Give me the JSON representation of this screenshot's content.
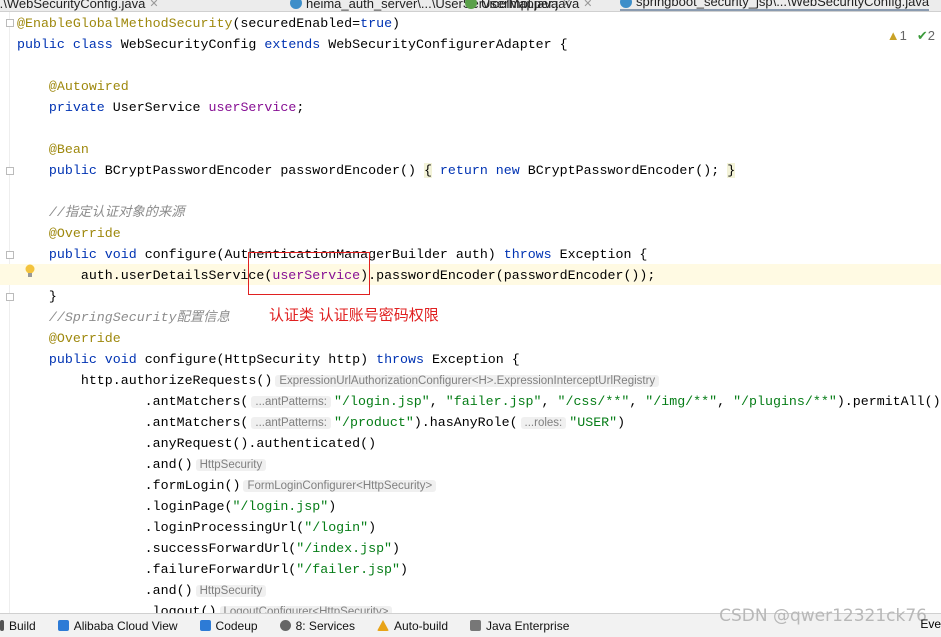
{
  "tabs": [
    {
      "label": "..\\WebSecurityConfig.java",
      "icon": "class-icon",
      "closable": true
    },
    {
      "label": "heima_auth_server\\...\\UserServiceImpl.java",
      "icon": "class-icon",
      "closable": true
    },
    {
      "label": "UserMapper.java",
      "icon": "interface-icon",
      "closable": true
    },
    {
      "label": "springboot_security_jsp\\...\\WebSecurityConfig.java",
      "icon": "class-icon",
      "active": true
    }
  ],
  "inspections": {
    "warnings": "1",
    "ok": "2"
  },
  "code": [
    [
      [
        "an",
        "@EnableGlobalMethodSecurity"
      ],
      [
        "",
        "(securedEnabled="
      ],
      [
        "kw",
        "true"
      ],
      [
        "",
        ")"
      ]
    ],
    [
      [
        "kw",
        "public class "
      ],
      [
        "",
        "WebSecurityConfig "
      ],
      [
        "kw",
        "extends "
      ],
      [
        "",
        "WebSecurityConfigurerAdapter {"
      ]
    ],
    [],
    [
      [
        "",
        "    "
      ],
      [
        "an",
        "@Autowired"
      ]
    ],
    [
      [
        "",
        "    "
      ],
      [
        "kw",
        "private "
      ],
      [
        "",
        "UserService "
      ],
      [
        "fld",
        "userService"
      ],
      [
        "",
        ";"
      ]
    ],
    [],
    [
      [
        "",
        "    "
      ],
      [
        "an",
        "@Bean"
      ]
    ],
    [
      [
        "",
        "    "
      ],
      [
        "kw",
        "public "
      ],
      [
        "",
        "BCryptPasswordEncoder passwordEncoder() "
      ],
      [
        "brace",
        "{"
      ],
      [
        "",
        ""
      ],
      [
        "kw",
        " return new "
      ],
      [
        "",
        "BCryptPasswordEncoder(); "
      ],
      [
        "brace",
        "}"
      ]
    ],
    [],
    [
      [
        "",
        "    "
      ],
      [
        "cm",
        "//指定认证对象的来源"
      ]
    ],
    [
      [
        "",
        "    "
      ],
      [
        "an",
        "@Override"
      ]
    ],
    [
      [
        "",
        "    "
      ],
      [
        "kw",
        "public void "
      ],
      [
        "",
        "configure(AuthenticationManagerBuilder auth) "
      ],
      [
        "kw",
        "throws "
      ],
      [
        "",
        "Exception {"
      ]
    ],
    [
      [
        "",
        "        auth.userDetailsService("
      ],
      [
        "fld",
        "userService"
      ],
      [
        "",
        ").passwordEncoder(passwordEncoder());"
      ]
    ],
    [
      [
        "",
        "    }"
      ]
    ],
    [
      [
        "",
        "    "
      ],
      [
        "cm",
        "//SpringSecurity配置信息"
      ]
    ],
    [
      [
        "",
        "    "
      ],
      [
        "an",
        "@Override"
      ]
    ],
    [
      [
        "",
        "    "
      ],
      [
        "kw",
        "public void "
      ],
      [
        "",
        "configure(HttpSecurity http) "
      ],
      [
        "kw",
        "throws "
      ],
      [
        "",
        "Exception {"
      ]
    ],
    [
      [
        "",
        "        http.authorizeRequests()"
      ],
      [
        "hint",
        "ExpressionUrlAuthorizationConfigurer<H>.ExpressionInterceptUrlRegistry"
      ]
    ],
    [
      [
        "",
        "                .antMatchers("
      ],
      [
        "hint",
        "...antPatterns:"
      ],
      [
        "str",
        "\"/login.jsp\""
      ],
      [
        "",
        ", "
      ],
      [
        "str",
        "\"failer.jsp\""
      ],
      [
        "",
        ", "
      ],
      [
        "str",
        "\"/css/**\""
      ],
      [
        "",
        ", "
      ],
      [
        "str",
        "\"/img/**\""
      ],
      [
        "",
        ", "
      ],
      [
        "str",
        "\"/plugins/**\""
      ],
      [
        "",
        ").permitAll()"
      ]
    ],
    [
      [
        "",
        "                .antMatchers("
      ],
      [
        "hint",
        "...antPatterns:"
      ],
      [
        "str",
        "\"/product\""
      ],
      [
        "",
        ").hasAnyRole("
      ],
      [
        "hint",
        "...roles:"
      ],
      [
        "str",
        "\"USER\""
      ],
      [
        "",
        ")"
      ]
    ],
    [
      [
        "",
        "                .anyRequest().authenticated()"
      ]
    ],
    [
      [
        "",
        "                .and()"
      ],
      [
        "hint",
        "HttpSecurity"
      ]
    ],
    [
      [
        "",
        "                .formLogin()"
      ],
      [
        "hint",
        "FormLoginConfigurer<HttpSecurity>"
      ]
    ],
    [
      [
        "",
        "                .loginPage("
      ],
      [
        "str",
        "\"/login.jsp\""
      ],
      [
        "",
        ")"
      ]
    ],
    [
      [
        "",
        "                .loginProcessingUrl("
      ],
      [
        "str",
        "\"/login\""
      ],
      [
        "",
        ")"
      ]
    ],
    [
      [
        "",
        "                .successForwardUrl("
      ],
      [
        "str",
        "\"/index.jsp\""
      ],
      [
        "",
        ")"
      ]
    ],
    [
      [
        "",
        "                .failureForwardUrl("
      ],
      [
        "str",
        "\"/failer.jsp\""
      ],
      [
        "",
        ")"
      ]
    ],
    [
      [
        "",
        "                .and()"
      ],
      [
        "hint",
        "HttpSecurity"
      ]
    ],
    [
      [
        "",
        "                .logout()"
      ],
      [
        "hint",
        "LogoutConfigurer<HttpSecurity>"
      ]
    ]
  ],
  "annotation": {
    "text": "认证类 认证账号密码权限",
    "color": "#e02020"
  },
  "status_bar": [
    {
      "label": "Build",
      "icon": "build-icon"
    },
    {
      "label": "Alibaba Cloud View",
      "icon": "cloud-icon"
    },
    {
      "label": "Codeup",
      "icon": "codeup-icon"
    },
    {
      "label": "8: Services",
      "icon": "services-icon"
    },
    {
      "label": "Auto-build",
      "icon": "warning-icon"
    },
    {
      "label": "Java Enterprise",
      "icon": "java-enterprise-icon"
    }
  ],
  "status_right": "Eve",
  "watermark": "CSDN @qwer12321ck76"
}
